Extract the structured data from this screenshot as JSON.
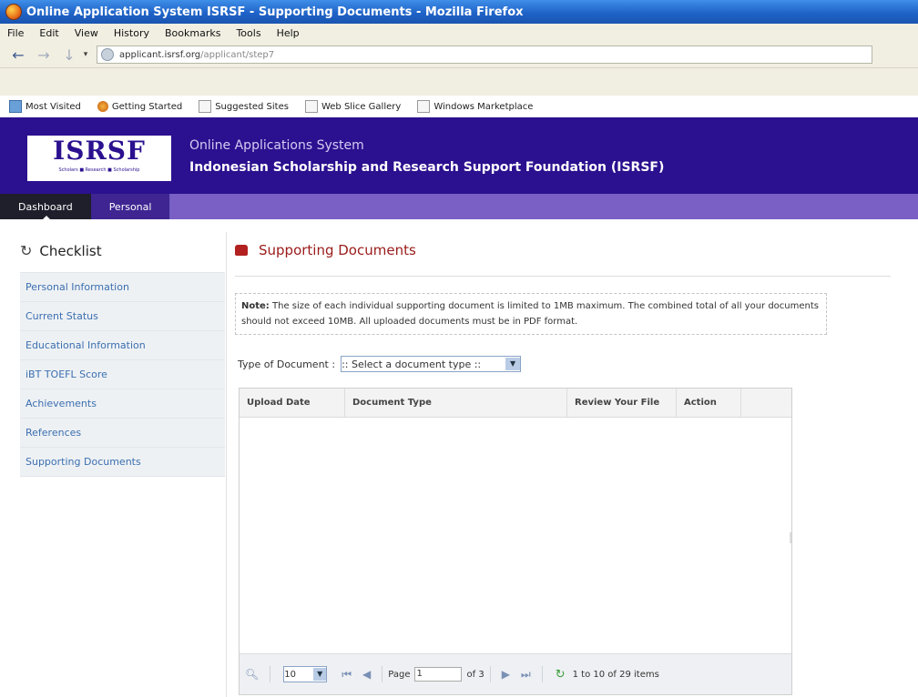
{
  "window": {
    "title": "Online Application System ISRSF - Supporting Documents - Mozilla Firefox"
  },
  "menubar": [
    "File",
    "Edit",
    "View",
    "History",
    "Bookmarks",
    "Tools",
    "Help"
  ],
  "url": {
    "domain": "applicant.isrsf.org",
    "path": "/applicant/step7"
  },
  "bookmarks": [
    "Most Visited",
    "Getting Started",
    "Suggested Sites",
    "Web Slice Gallery",
    "Windows Marketplace"
  ],
  "site": {
    "logo_text": "ISRSF",
    "logo_tagline": "Scholars ■ Research ■ Scholarship",
    "subtitle": "Online Applications System",
    "title": "Indonesian Scholarship and Research Support Foundation (ISRSF)"
  },
  "tabs": [
    "Dashboard",
    "Personal"
  ],
  "sidebar": {
    "heading": "Checklist",
    "items": [
      "Personal Information",
      "Current Status",
      "Educational Information",
      "iBT TOEFL Score",
      "Achievements",
      "References",
      "Supporting Documents"
    ]
  },
  "main": {
    "title": "Supporting Documents",
    "note_label": "Note:",
    "note_text": " The size of each individual supporting document is limited to 1MB maximum. The combined total of all your documents should not exceed 10MB. All uploaded documents must be in PDF format.",
    "type_label": "Type of Document :",
    "type_select": ":: Select a document type ::"
  },
  "grid": {
    "columns": [
      "Upload Date",
      "Document Type",
      "Review Your File",
      "Action"
    ],
    "page_size": "10",
    "page_label": "Page",
    "page_value": "1",
    "of_label": "of 3",
    "items_info": "1 to 10 of 29 items"
  },
  "colors": {
    "header_bg": "#2b108f",
    "tabs_bg": "#3b1f94",
    "title_red": "#9a1a1a"
  }
}
